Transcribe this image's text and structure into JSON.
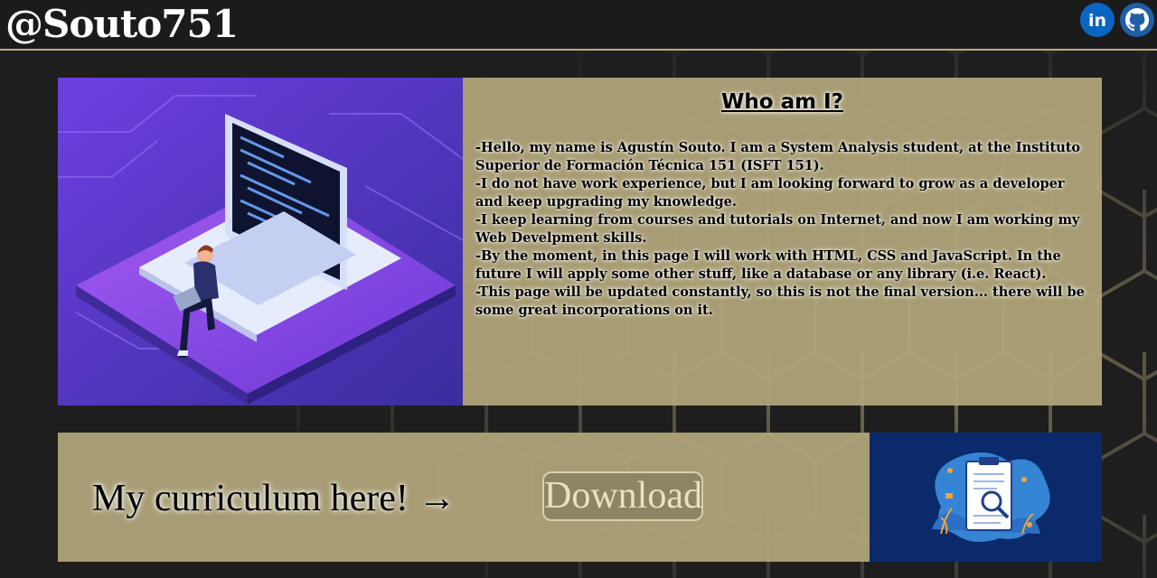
{
  "header": {
    "brand": "@Souto751",
    "social": [
      {
        "name": "linkedin",
        "label": "in"
      },
      {
        "name": "github",
        "label": ""
      }
    ]
  },
  "about": {
    "title": "Who am I?",
    "paragraphs": [
      "-Hello, my name is Agustín Souto. I am a System Analysis student, at the Instituto Superior de Formación Técnica 151 (ISFT 151).",
      "-I do not have work experience, but I am looking forward to grow as a developer and keep upgrading my knowledge.",
      "-I keep learning from courses and tutorials on Internet, and now I am working my Web Develpment skills.",
      "-By the moment, in this page I will work with HTML, CSS and JavaScript. In the future I will apply some other stuff, like a database or any library (i.e. React).",
      "-This page will be updated constantly, so this is not the final version... there will be some great incorporations on it."
    ]
  },
  "cv": {
    "label": "My curriculum here! →",
    "download_label": "Download"
  },
  "colors": {
    "panel": "#b1a67a",
    "header_border": "#b9ad7c",
    "background": "#1e1e1e"
  }
}
